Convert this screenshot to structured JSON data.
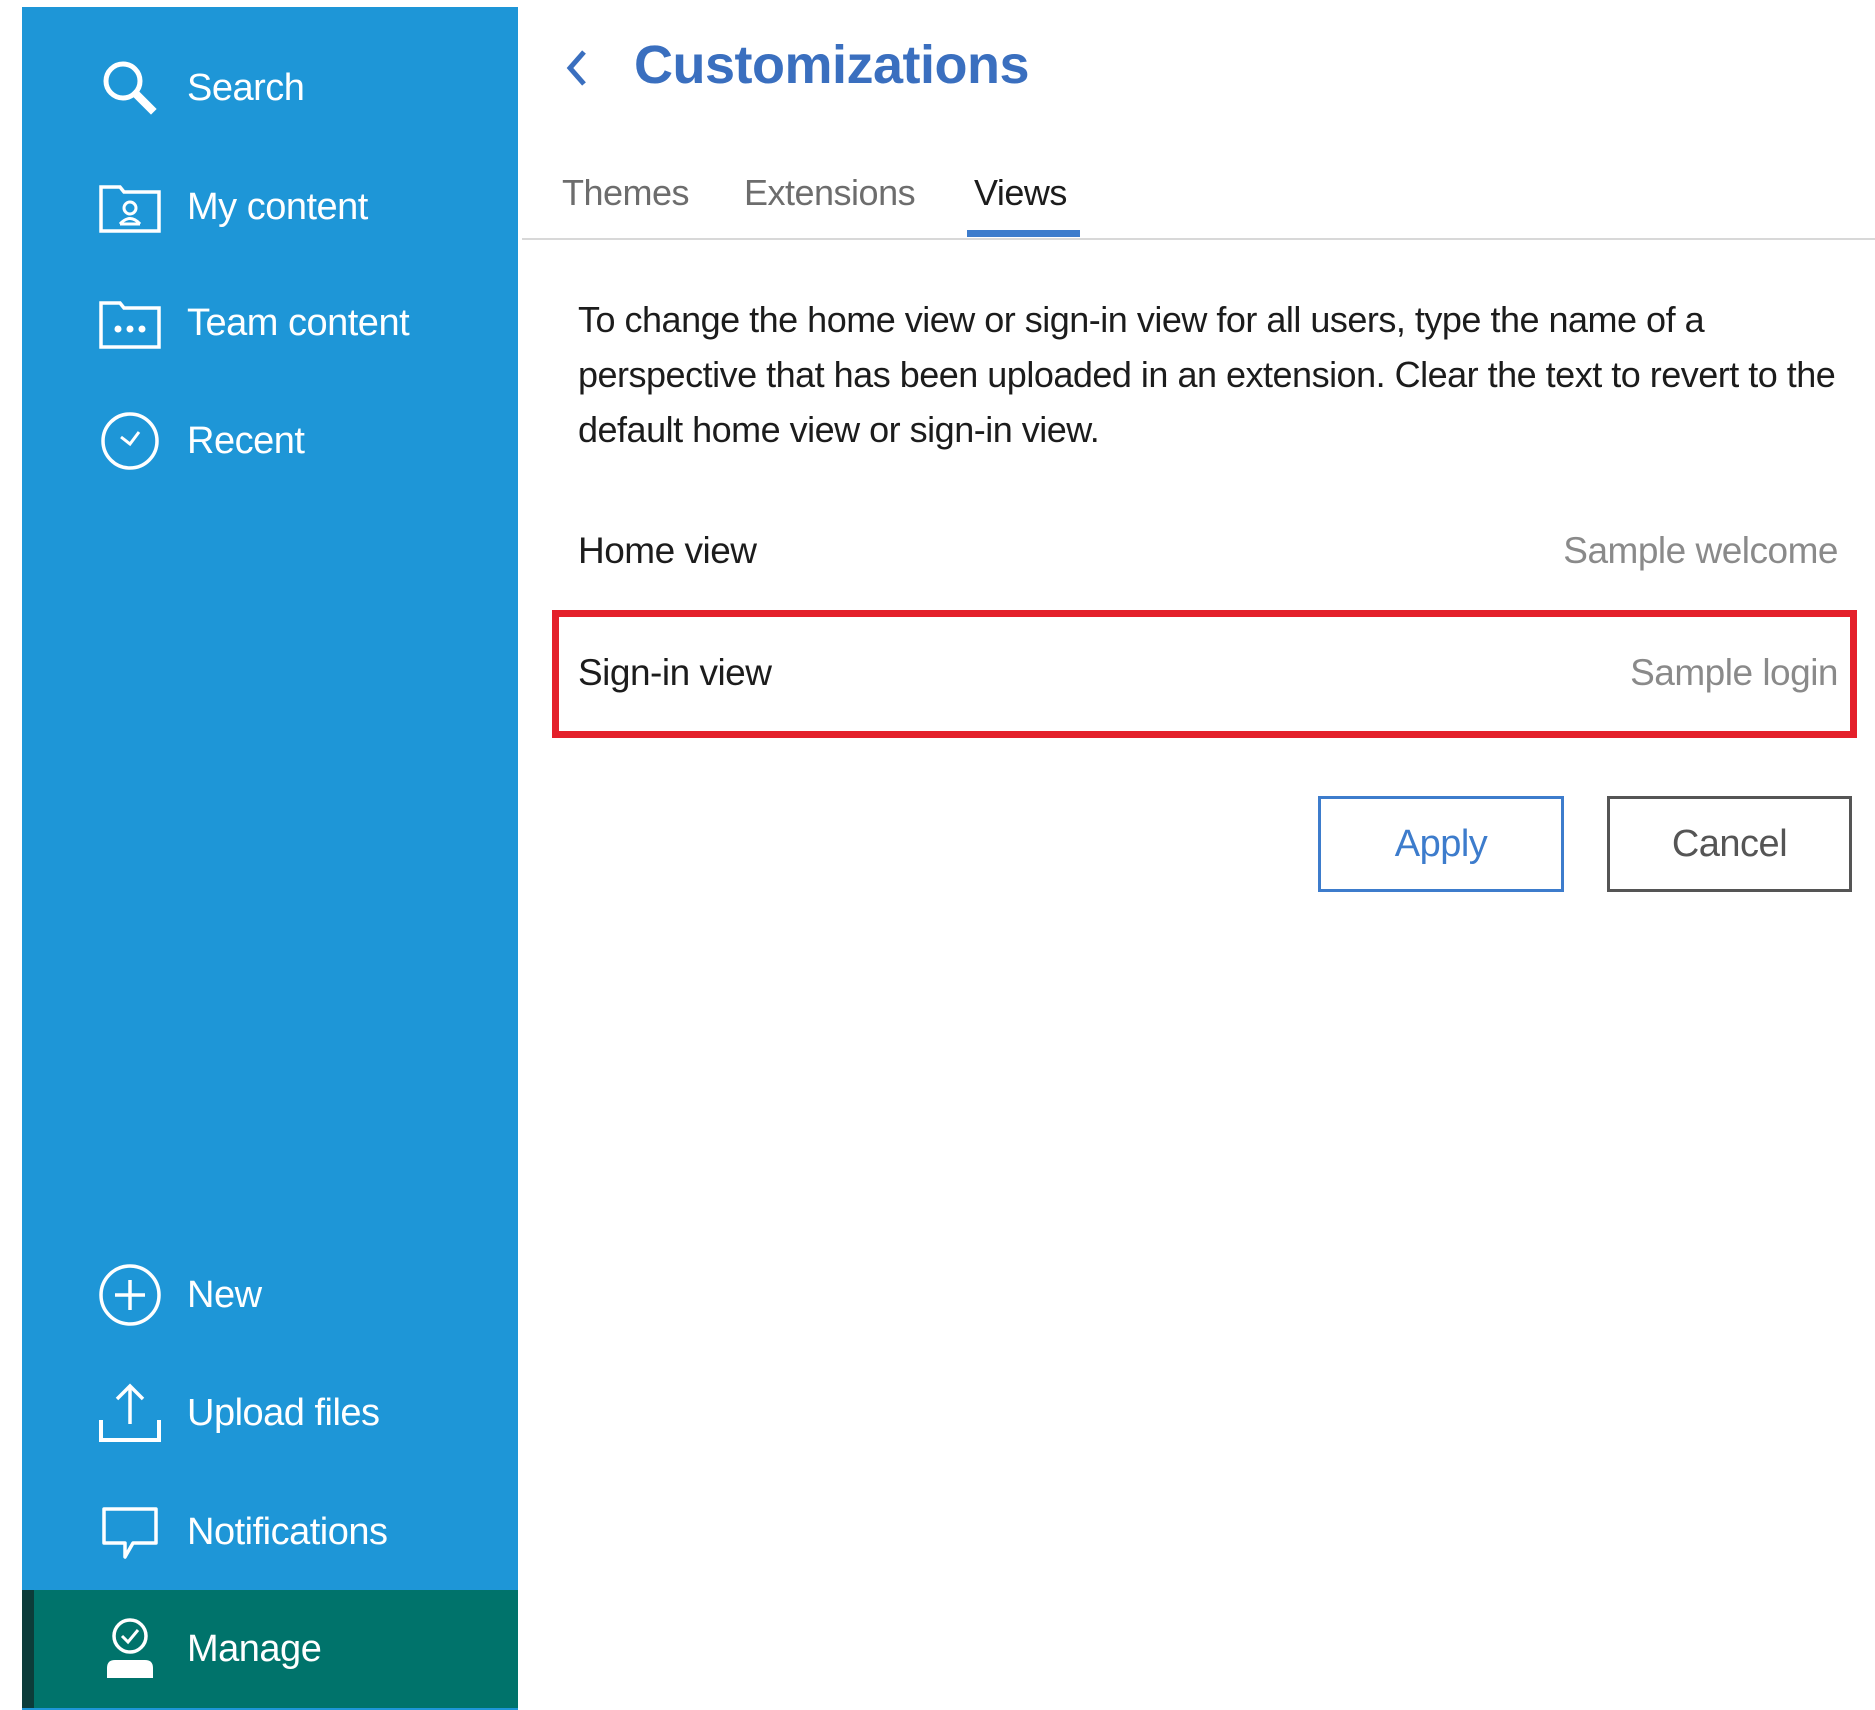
{
  "sidebar": {
    "top_items": [
      {
        "label": "Search",
        "icon": "search-icon"
      },
      {
        "label": "My content",
        "icon": "my-content-folder-icon"
      },
      {
        "label": "Team content",
        "icon": "team-content-folder-icon"
      },
      {
        "label": "Recent",
        "icon": "clock-icon"
      }
    ],
    "bottom_items": [
      {
        "label": "New",
        "icon": "plus-circle-icon"
      },
      {
        "label": "Upload files",
        "icon": "upload-icon"
      },
      {
        "label": "Notifications",
        "icon": "speech-bubble-icon"
      },
      {
        "label": "Manage",
        "icon": "manage-user-icon",
        "active": true
      }
    ],
    "colors": {
      "background": "#1e96d7",
      "active": "#00736b"
    }
  },
  "header": {
    "title": "Customizations"
  },
  "tabs": [
    {
      "label": "Themes",
      "active": false
    },
    {
      "label": "Extensions",
      "active": false
    },
    {
      "label": "Views",
      "active": true
    }
  ],
  "views": {
    "description": "To change the home view or sign-in view for all users, type the name of a perspective that has been uploaded in an extension. Clear the text to revert to the default home view or sign-in view.",
    "home_view": {
      "label": "Home view",
      "value": "Sample welcome"
    },
    "signin_view": {
      "label": "Sign-in view",
      "value": "Sample login"
    }
  },
  "actions": {
    "apply_label": "Apply",
    "cancel_label": "Cancel"
  },
  "colors": {
    "accent": "#3d7ccc",
    "highlight": "#e4202a"
  }
}
